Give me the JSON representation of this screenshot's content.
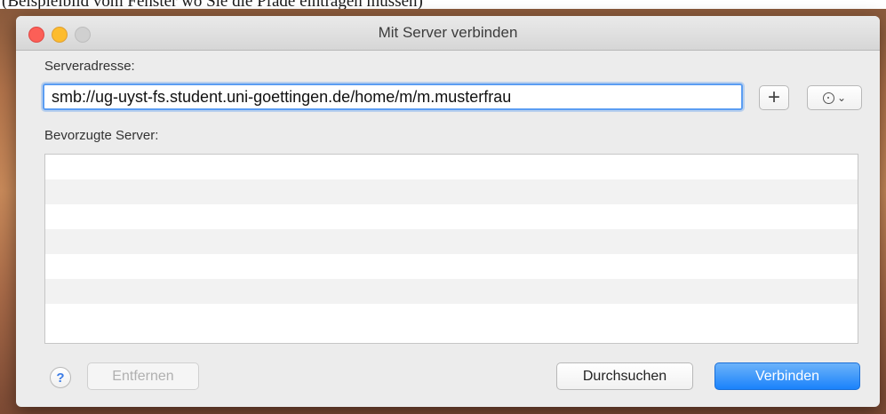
{
  "caption": "(Beispielbild vom Fenster wo Sie die Pfade eintragen müssen)",
  "window": {
    "title": "Mit Server verbinden"
  },
  "form": {
    "address_label": "Serveradresse:",
    "address_value": "smb://ug-uyst-fs.student.uni-goettingen.de/home/m/m.musterfrau",
    "add_button_label": "+",
    "favorites_label": "Bevorzugte Server:"
  },
  "favorites": {
    "items": [
      "",
      "",
      "",
      "",
      "",
      "",
      ""
    ]
  },
  "footer": {
    "help_label": "?",
    "remove_label": "Entfernen",
    "browse_label": "Durchsuchen",
    "connect_label": "Verbinden"
  },
  "icons": {
    "history": "clock-icon",
    "chevron": "chevron-down-icon"
  },
  "colors": {
    "close": "#fc5f57",
    "minimize": "#fdbc2e",
    "zoom": "#d0d0d0",
    "accent": "#1a82fb",
    "focus_ring": "#5b9df2"
  }
}
